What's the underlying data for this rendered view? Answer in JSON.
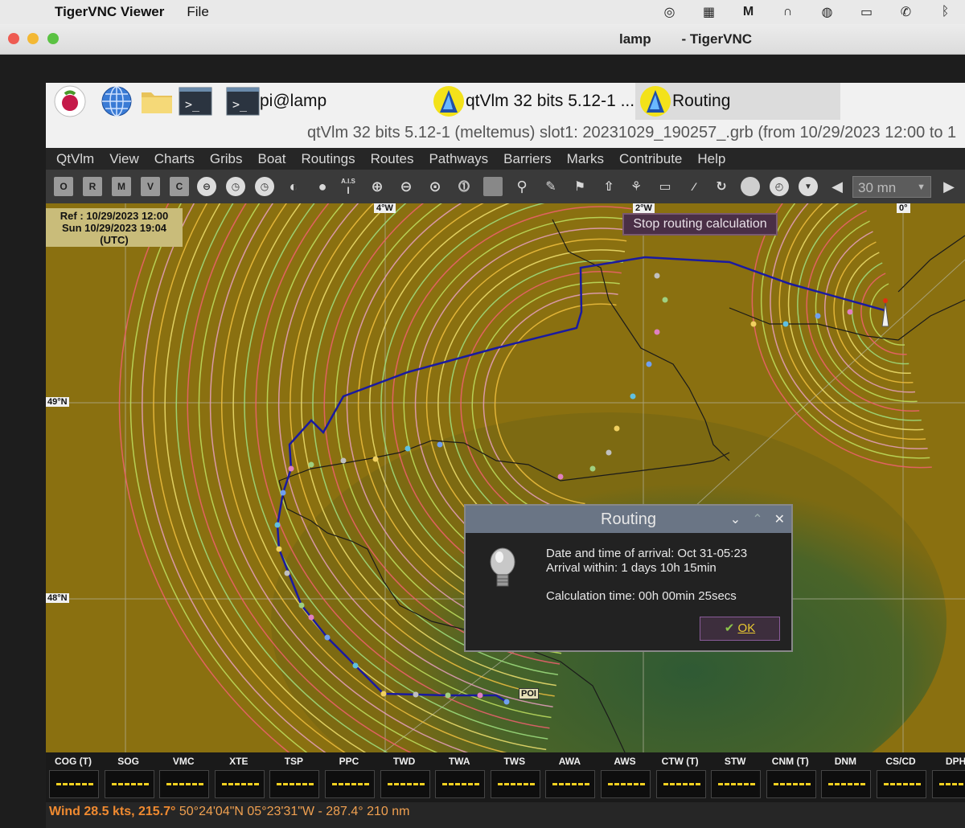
{
  "mac_menubar": {
    "app_name": "TigerVNC Viewer",
    "menu_file": "File"
  },
  "window": {
    "title": "lamp        - TigerVNC"
  },
  "taskbar": {
    "terminal_task": "pi@lamp",
    "qtvlm_task": "qtVlm 32 bits 5.12-1 ...",
    "routing_task": "Routing"
  },
  "subtitle": "qtVlm 32 bits 5.12-1 (meltemus) slot1: 20231029_190257_.grb (from 10/29/2023 12:00 to 1",
  "menu": [
    "QtVlm",
    "View",
    "Charts",
    "Gribs",
    "Boat",
    "Routings",
    "Routes",
    "Pathways",
    "Barriers",
    "Marks",
    "Contribute",
    "Help"
  ],
  "toolbar": {
    "grib_buttons": [
      "O",
      "R",
      "M",
      "V",
      "C"
    ],
    "ais_label": "A.I.S",
    "interval": "30 mn"
  },
  "map": {
    "ref_line": "Ref : 10/29/2023 12:00",
    "date_line": "Sun 10/29/2023 19:04",
    "tz_line": "(UTC)",
    "stop_button": "Stop routing calculation",
    "lat_labels": [
      "49°N",
      "48°N"
    ],
    "lon_labels": [
      "4°W",
      "2°W",
      "0°"
    ],
    "poi_label": "POI"
  },
  "dialog": {
    "title": "Routing",
    "arrival": "Date and time of arrival: Oct 31-05:23",
    "within": "Arrival within: 1 days 10h 15min",
    "calc_time": "Calculation time: 00h 00min 25secs",
    "ok": "OK"
  },
  "instruments": [
    "COG (T)",
    "SOG",
    "VMC",
    "XTE",
    "TSP",
    "PPC",
    "TWD",
    "TWA",
    "TWS",
    "AWA",
    "AWS",
    "CTW (T)",
    "STW",
    "CNM (T)",
    "DNM",
    "CS/CD",
    "DPH"
  ],
  "status": {
    "wind": "Wind 28.5 kts, 215.7°",
    "position": " 50°24'04\"N 05°23'31\"W - 287.4° 210 nm"
  },
  "colors": {
    "route": "#1a1aa0",
    "menubar_bg": "#262626",
    "status_wind": "#f08a30",
    "ok_text": "#e8c830"
  }
}
